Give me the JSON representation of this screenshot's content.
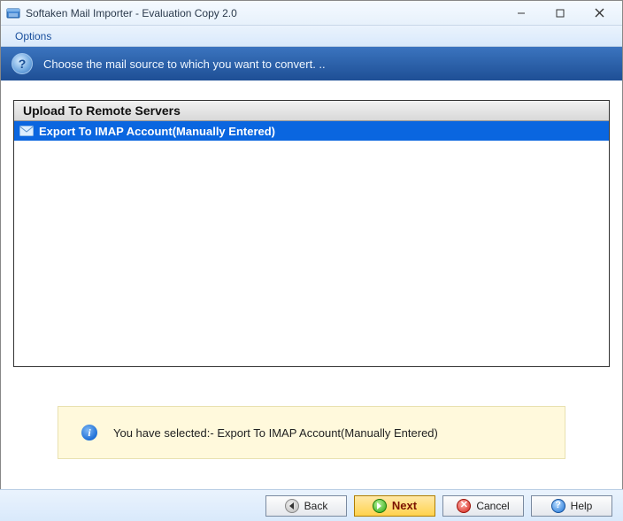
{
  "window": {
    "title": "Softaken Mail Importer - Evaluation Copy 2.0"
  },
  "menu": {
    "options": "Options"
  },
  "header": {
    "text": "Choose the mail source to which you want to convert. .."
  },
  "list": {
    "section_header": "Upload To Remote Servers",
    "items": [
      {
        "label": "Export To IMAP Account(Manually Entered)",
        "selected": true
      }
    ]
  },
  "info": {
    "text": "You have selected:- Export To IMAP Account(Manually Entered)"
  },
  "buttons": {
    "back": "Back",
    "next": "Next",
    "cancel": "Cancel",
    "help": "Help"
  }
}
